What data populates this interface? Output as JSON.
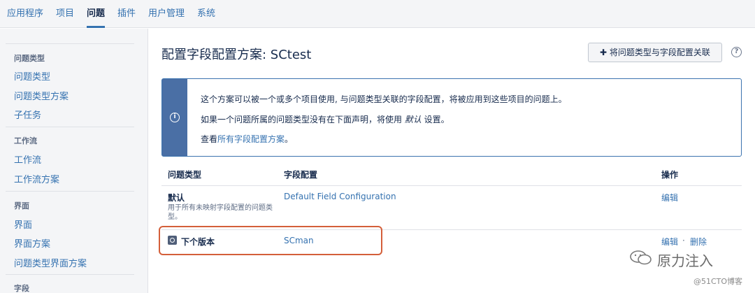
{
  "nav": {
    "tabs": [
      "应用程序",
      "项目",
      "问题",
      "插件",
      "用户管理",
      "系统"
    ],
    "active_index": 2
  },
  "sidebar": {
    "sections": [
      {
        "header": "问题类型",
        "items": [
          "问题类型",
          "问题类型方案",
          "子任务"
        ]
      },
      {
        "header": "工作流",
        "items": [
          "工作流",
          "工作流方案"
        ]
      },
      {
        "header": "界面",
        "items": [
          "界面",
          "界面方案",
          "问题类型界面方案"
        ]
      },
      {
        "header": "字段",
        "items": []
      }
    ]
  },
  "page": {
    "title": "配置字段配置方案: SCtest",
    "assoc_button": "将问题类型与字段配置关联",
    "help_icon": "?"
  },
  "info": {
    "line1": "这个方案可以被一个或多个项目使用, 与问题类型关联的字段配置，将被应用到这些项目的问题上。",
    "line2_pre": "如果一个问题所属的问题类型没有在下面声明，将使用 ",
    "line2_em": "默认",
    "line2_post": " 设置。",
    "line3_pre": "查看",
    "line3_link": "所有字段配置方案",
    "line3_post": "。"
  },
  "table": {
    "headers": [
      "问题类型",
      "字段配置",
      "操作"
    ],
    "rows": [
      {
        "issue_type": "默认",
        "desc": "用于所有未映射字段配置的问题类型。",
        "field_config": "Default Field Configuration",
        "actions": [
          "编辑"
        ]
      },
      {
        "issue_type": "下个版本",
        "field_config": "SCman",
        "actions": [
          "编辑",
          "删除"
        ]
      }
    ]
  },
  "watermark": {
    "text": "原力注入",
    "small": "@51CTO博客"
  },
  "colors": {
    "link": "#3572b0",
    "info_bar": "#4a6fa5",
    "highlight": "#d45f3a"
  }
}
